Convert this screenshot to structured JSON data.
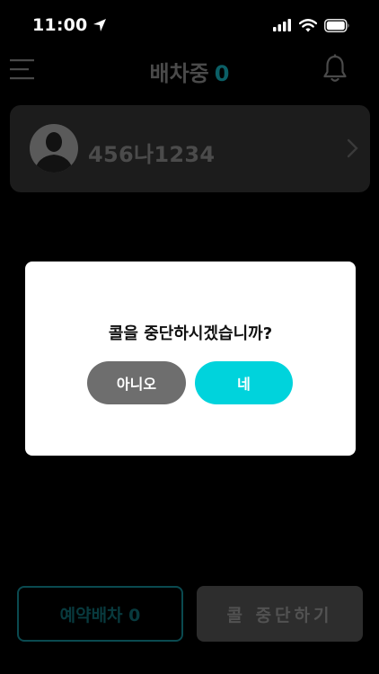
{
  "status_bar": {
    "time": "11:00",
    "location_icon": "location-arrow-icon",
    "signal_icon": "cellular-signal-icon",
    "wifi_icon": "wifi-icon",
    "battery_icon": "battery-icon"
  },
  "header": {
    "title": "배차중",
    "count": "0",
    "menu_icon": "hamburger-menu-icon",
    "bell_icon": "bell-icon"
  },
  "driver_card": {
    "plate": "456나1234",
    "avatar_icon": "person-avatar-icon",
    "chevron_icon": "chevron-right-icon"
  },
  "bottom": {
    "reserve_label": "예약배차 0",
    "stop_call_label": "콜 중단하기"
  },
  "modal": {
    "message": "콜을 중단하시겠습니까?",
    "no_label": "아니오",
    "yes_label": "네"
  },
  "colors": {
    "background": "#000000",
    "accent": "#00d3dc",
    "card": "#1c1c1c",
    "no_button": "#6e6e6e"
  }
}
